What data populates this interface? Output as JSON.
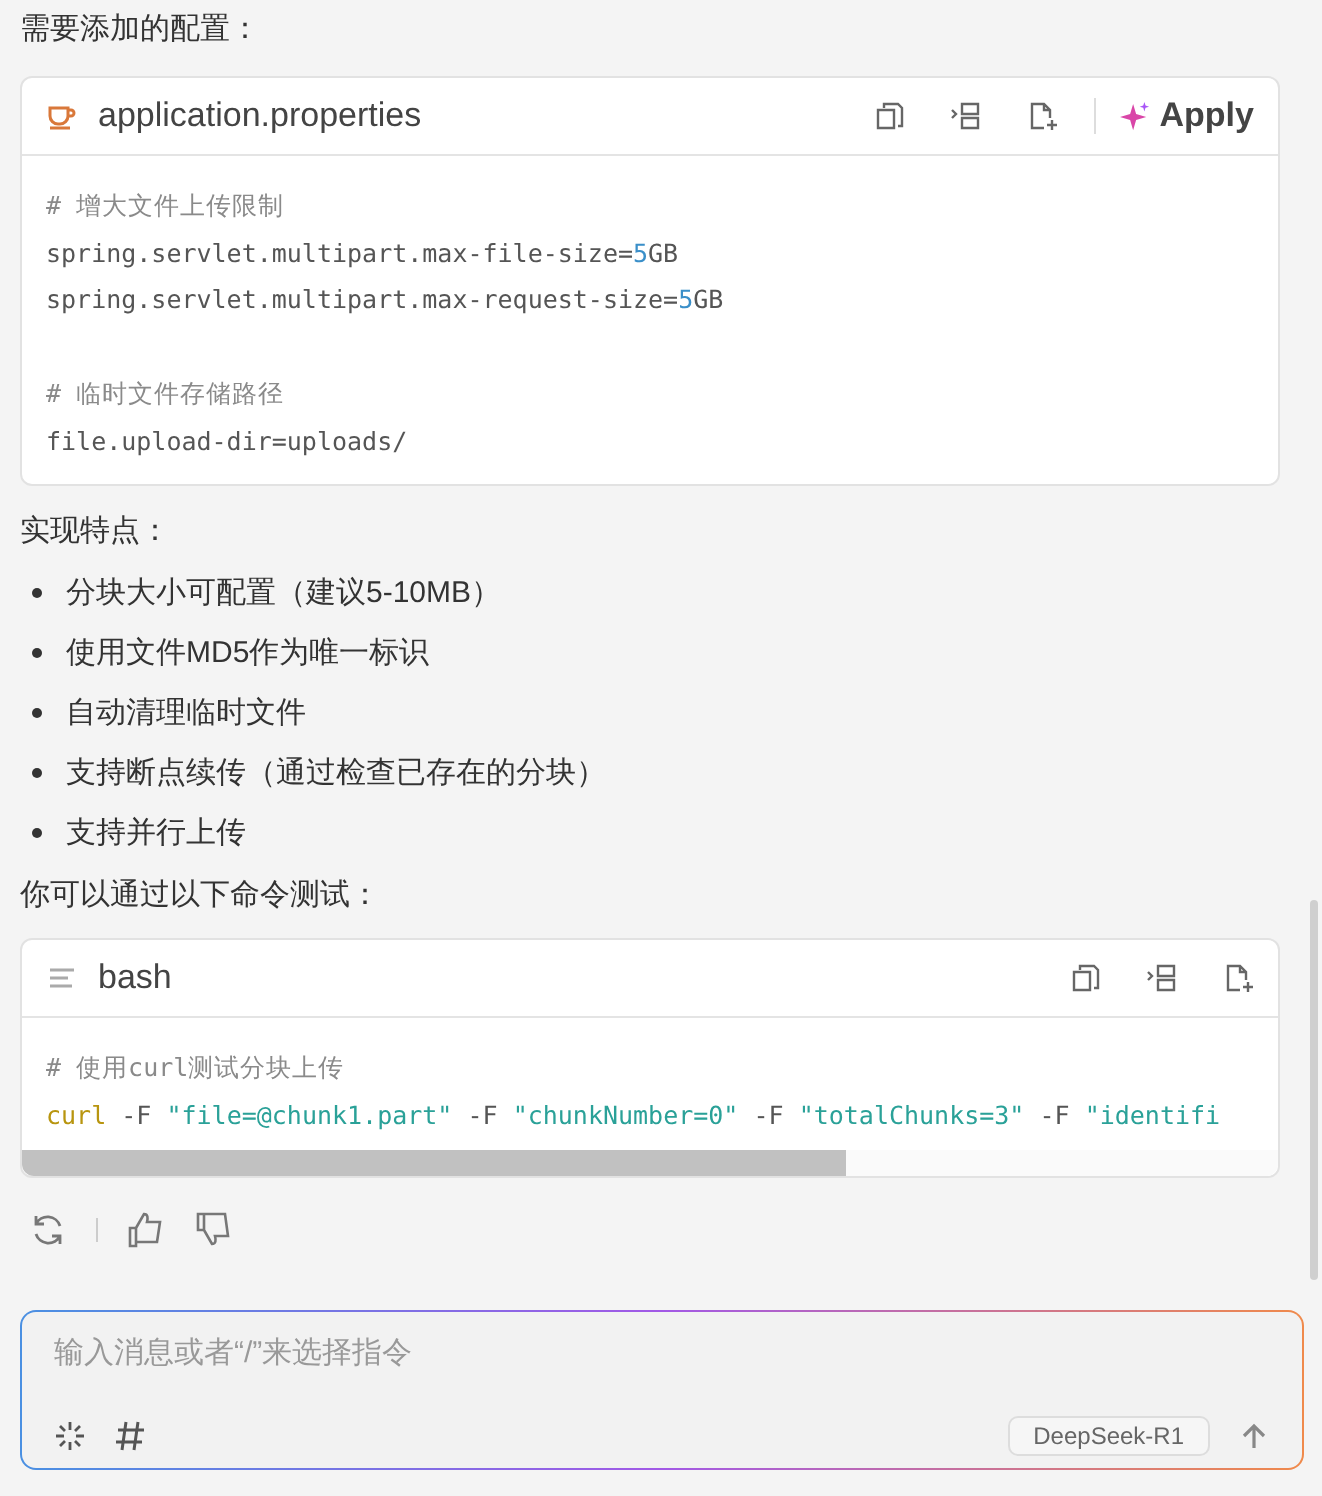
{
  "intro": "需要添加的配置：",
  "config_block": {
    "filename": "application.properties",
    "apply_label": "Apply",
    "lines": [
      {
        "kind": "code",
        "tokens": [
          {
            "kind": "comment",
            "text": "# 增大文件上传限制"
          }
        ]
      },
      {
        "kind": "code",
        "tokens": [
          {
            "kind": "plain",
            "text": "spring.servlet.multipart.max-file-size="
          },
          {
            "kind": "number",
            "text": "5"
          },
          {
            "kind": "plain",
            "text": "GB"
          }
        ]
      },
      {
        "kind": "code",
        "tokens": [
          {
            "kind": "plain",
            "text": "spring.servlet.multipart.max-request-size="
          },
          {
            "kind": "number",
            "text": "5"
          },
          {
            "kind": "plain",
            "text": "GB"
          }
        ]
      },
      {
        "kind": "blank"
      },
      {
        "kind": "code",
        "tokens": [
          {
            "kind": "comment",
            "text": "# 临时文件存储路径"
          }
        ]
      },
      {
        "kind": "code",
        "tokens": [
          {
            "kind": "plain",
            "text": "file.upload-dir=uploads/"
          }
        ]
      }
    ]
  },
  "features_heading": "实现特点：",
  "features": [
    "分块大小可配置（建议5-10MB）",
    "使用文件MD5作为唯一标识",
    "自动清理临时文件",
    "支持断点续传（通过检查已存在的分块）",
    "支持并行上传"
  ],
  "test_heading": "你可以通过以下命令测试：",
  "bash_block": {
    "language": "bash",
    "lines": [
      [
        {
          "kind": "comment",
          "text": "# 使用curl测试分块上传"
        }
      ],
      [
        {
          "kind": "keyword",
          "text": "curl"
        },
        {
          "kind": "plain",
          "text": " -F "
        },
        {
          "kind": "string",
          "text": "\"file=@chunk1.part\""
        },
        {
          "kind": "plain",
          "text": " -F "
        },
        {
          "kind": "string",
          "text": "\"chunkNumber=0\""
        },
        {
          "kind": "plain",
          "text": " -F "
        },
        {
          "kind": "string",
          "text": "\"totalChunks=3\""
        },
        {
          "kind": "plain",
          "text": " -F "
        },
        {
          "kind": "string",
          "text": "\"identifi"
        }
      ]
    ]
  },
  "composer": {
    "placeholder": "输入消息或者“/”来选择指令",
    "model": "DeepSeek-R1"
  }
}
